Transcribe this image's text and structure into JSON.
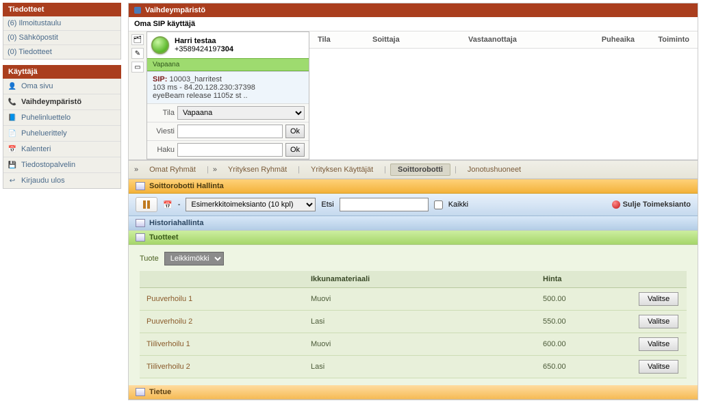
{
  "sidebar": {
    "sec1_title": "Tiedotteet",
    "sec1_items": [
      {
        "label": "(6) Ilmoitustaulu"
      },
      {
        "label": "(0) Sähköpostit"
      },
      {
        "label": "(0) Tiedotteet"
      }
    ],
    "sec2_title": "Käyttäjä",
    "sec2_items": [
      {
        "label": "Oma sivu"
      },
      {
        "label": "Vaihdeympäristö"
      },
      {
        "label": "Puhelinluettelo"
      },
      {
        "label": "Puheluerittely"
      },
      {
        "label": "Kalenteri"
      },
      {
        "label": "Tiedostopalvelin"
      },
      {
        "label": "Kirjaudu ulos"
      }
    ]
  },
  "main": {
    "title": "Vaihdeympäristö",
    "subtitle": "Oma SIP käyttäjä",
    "user": {
      "name": "Harri testaa",
      "phone_prefix": "+3589424197",
      "phone_bold": "304",
      "status": "Vapaana",
      "sip_label": "SIP:",
      "sip_value": "10003_harritest",
      "sip_line2": "103 ms - 84.20.128.230:37398",
      "sip_line3": "eyeBeam release 1105z st ..",
      "tila_label": "Tila",
      "tila_value": "Vapaana",
      "viesti_label": "Viesti",
      "haku_label": "Haku",
      "ok": "Ok"
    },
    "call_cols": {
      "tila": "Tila",
      "soittaja": "Soittaja",
      "vastaanottaja": "Vastaanottaja",
      "puheaika": "Puheaika",
      "toiminto": "Toiminto"
    },
    "tabs": {
      "t1": "Omat Ryhmät",
      "t2": "Yrityksen Ryhmät",
      "t3": "Yrityksen Käyttäjät",
      "t4": "Soittorobotti",
      "t5": "Jonotushuoneet",
      "caret": "»"
    },
    "robot": {
      "title": "Soittorobotti Hallinta",
      "select": "Esimerkkitoimeksianto (10 kpl)",
      "etsi": "Etsi",
      "kaikki": "Kaikki",
      "close": "Sulje Toimeksianto",
      "dash": "-"
    },
    "sections": {
      "hist": "Historiahallinta",
      "tuot": "Tuotteet",
      "tietue": "Tietue"
    },
    "products": {
      "tuote_label": "Tuote",
      "tuote_value": "Leikkimökki",
      "col_ikkuna": "Ikkunamateriaali",
      "col_hinta": "Hinta",
      "valitse": "Valitse",
      "rows": [
        {
          "name": "Puuverhoilu 1",
          "mat": "Muovi",
          "price": "500.00"
        },
        {
          "name": "Puuverhoilu 2",
          "mat": "Lasi",
          "price": "550.00"
        },
        {
          "name": "Tiiliverhoilu 1",
          "mat": "Muovi",
          "price": "600.00"
        },
        {
          "name": "Tiiliverhoilu 2",
          "mat": "Lasi",
          "price": "650.00"
        }
      ]
    }
  }
}
